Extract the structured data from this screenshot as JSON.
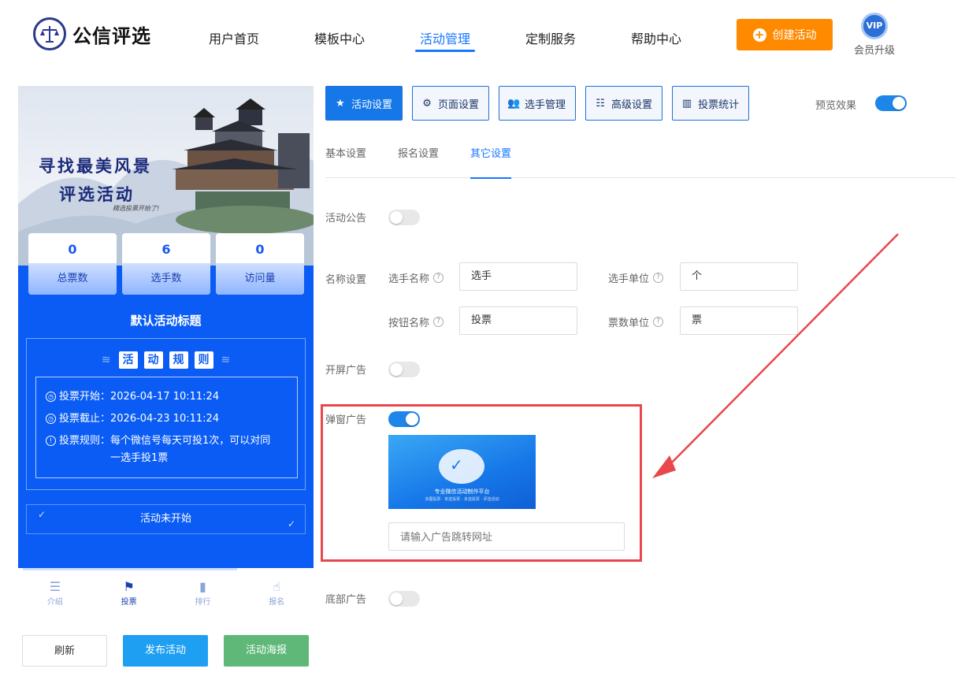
{
  "header": {
    "brand": "公信评选",
    "nav": [
      {
        "label": "用户首页",
        "active": false
      },
      {
        "label": "模板中心",
        "active": false
      },
      {
        "label": "活动管理",
        "active": true
      },
      {
        "label": "定制服务",
        "active": false
      },
      {
        "label": "帮助中心",
        "active": false
      }
    ],
    "create_button": "创建活动",
    "vip_badge": "VIP",
    "vip_label": "会员升级"
  },
  "preview": {
    "hero_title_1": "寻找最美风景",
    "hero_title_2": "评选活动",
    "hero_sub": "精选投票开始了!",
    "stats": [
      {
        "value": "0",
        "label": "总票数"
      },
      {
        "value": "6",
        "label": "选手数"
      },
      {
        "value": "0",
        "label": "访问量"
      }
    ],
    "activity_title": "默认活动标题",
    "rules_chars": [
      "活",
      "动",
      "规",
      "则"
    ],
    "rules": [
      {
        "label": "投票开始：",
        "value": "2026-04-17 10:11:24"
      },
      {
        "label": "投票截止：",
        "value": "2026-04-23 10:11:24"
      },
      {
        "label": "投票规则：",
        "value": "每个微信号每天可投1次，可以对同一选手投1票"
      }
    ],
    "status": "活动未开始",
    "tabbar": [
      {
        "label": "介绍",
        "icon": "list-icon"
      },
      {
        "label": "投票",
        "icon": "flag-icon"
      },
      {
        "label": "排行",
        "icon": "bar-chart-icon"
      },
      {
        "label": "报名",
        "icon": "hand-pointer-icon"
      }
    ]
  },
  "actions": {
    "refresh": "刷新",
    "publish": "发布活动",
    "poster": "活动海报"
  },
  "settings": {
    "main_tabs": [
      {
        "label": "活动设置",
        "icon": "star-icon",
        "active": true
      },
      {
        "label": "页面设置",
        "icon": "gear-icon",
        "active": false
      },
      {
        "label": "选手管理",
        "icon": "users-icon",
        "active": false
      },
      {
        "label": "高级设置",
        "icon": "sliders-icon",
        "active": false
      },
      {
        "label": "投票统计",
        "icon": "stats-icon",
        "active": false
      }
    ],
    "preview_label": "预览效果",
    "preview_on": true,
    "sub_tabs": [
      {
        "label": "基本设置",
        "active": false
      },
      {
        "label": "报名设置",
        "active": false
      },
      {
        "label": "其它设置",
        "active": true
      }
    ],
    "announcement_label": "活动公告",
    "announcement_on": false,
    "name_label": "名称设置",
    "player_name_label": "选手名称",
    "player_name_value": "选手",
    "player_unit_label": "选手单位",
    "player_unit_value": "个",
    "button_name_label": "按钮名称",
    "button_name_value": "投票",
    "vote_unit_label": "票数单位",
    "vote_unit_value": "票",
    "splash_ad_label": "开屏广告",
    "splash_ad_on": false,
    "popup_ad_label": "弹窗广告",
    "popup_ad_on": true,
    "popup_banner_text": "专业微信活动制作平台",
    "popup_banner_sub": "多图投票 · 单选投票 · 多选投票 · 评选活动",
    "popup_url_placeholder": "请输入广告跳转网址",
    "bottom_ad_label": "底部广告",
    "bottom_ad_on": false
  },
  "colors": {
    "primary": "#1677ff",
    "orange": "#ff8a00",
    "preview_blue": "#0a5cf5",
    "highlight_red": "#e8474c"
  }
}
